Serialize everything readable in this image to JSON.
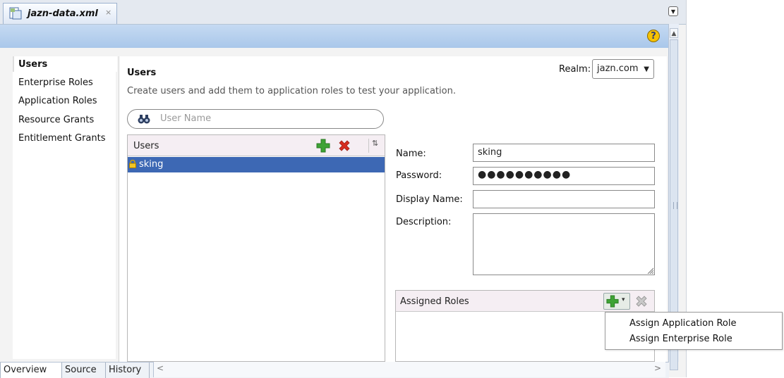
{
  "editor_tab": {
    "title": "jazn-data.xml",
    "close": "×"
  },
  "help": {
    "glyph": "?"
  },
  "nav": {
    "items": [
      "Users",
      "Enterprise Roles",
      "Application Roles",
      "Resource Grants",
      "Entitlement Grants"
    ],
    "active": "Users"
  },
  "section": {
    "title": "Users",
    "description": "Create users and add them to application roles to test your application."
  },
  "realm": {
    "label": "Realm:",
    "value": "jazn.com"
  },
  "search": {
    "placeholder": "User Name"
  },
  "users_list": {
    "header": "Users",
    "rows": [
      {
        "name": "sking",
        "selected": true
      }
    ]
  },
  "form": {
    "name_label": "Name:",
    "name_value": "sking",
    "password_label": "Password:",
    "password_value": "●●●●●●●●●●",
    "display_name_label": "Display Name:",
    "display_name_value": "",
    "description_label": "Description:",
    "description_value": ""
  },
  "assigned_roles": {
    "header": "Assigned Roles"
  },
  "assign_menu": {
    "items": [
      "Assign Application Role",
      "Assign Enterprise Role"
    ]
  },
  "bottom_tabs": [
    "Overview",
    "Source",
    "History"
  ],
  "colors": {
    "selection": "#3d68b4",
    "band": "#b6d0ee",
    "add_green": "#3ea335",
    "remove_red": "#d62d20"
  }
}
